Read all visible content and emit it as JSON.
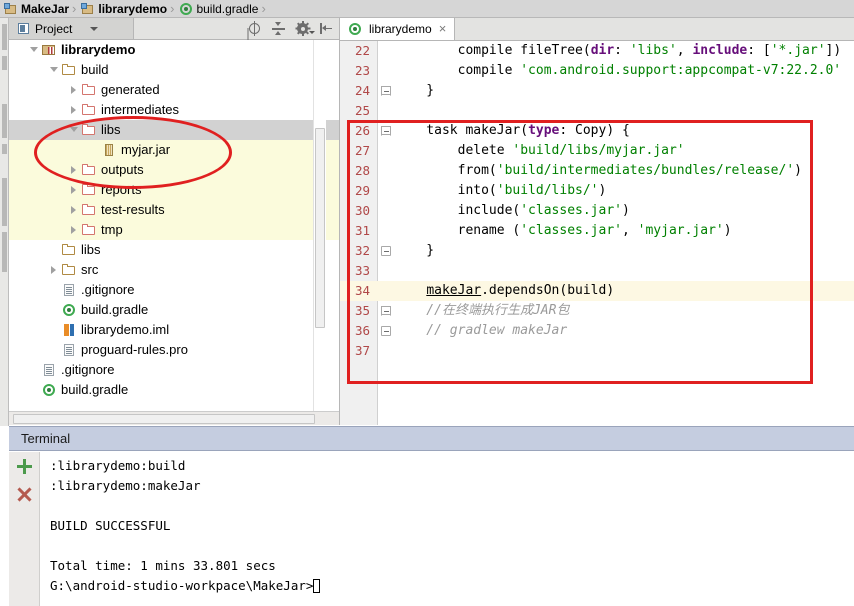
{
  "breadcrumb": {
    "items": [
      {
        "label": "MakeJar",
        "icon": "module-icon",
        "bold": true
      },
      {
        "label": "librarydemo",
        "icon": "module-icon",
        "bold": true
      },
      {
        "label": "build.gradle",
        "icon": "gradle-icon",
        "bold": false
      }
    ],
    "separator": "›"
  },
  "project_panel": {
    "tab_label": "Project",
    "tools": [
      {
        "name": "locate-icon",
        "title": "Scroll from Source"
      },
      {
        "name": "collapse-all-icon",
        "title": "Collapse All"
      },
      {
        "name": "gear-icon",
        "title": "Settings"
      },
      {
        "name": "hide-window-icon",
        "title": "Hide"
      }
    ],
    "tree": [
      {
        "label": "librarydemo",
        "indent": 0,
        "icon": "library-module-icon",
        "twisty": "open",
        "bold": true,
        "state": "normal"
      },
      {
        "label": "build",
        "indent": 1,
        "icon": "folder-icon",
        "twisty": "open",
        "bold": false,
        "state": "normal"
      },
      {
        "label": "generated",
        "indent": 2,
        "icon": "folder-red-icon",
        "twisty": "closed",
        "bold": false,
        "state": "normal"
      },
      {
        "label": "intermediates",
        "indent": 2,
        "icon": "folder-red-icon",
        "twisty": "closed",
        "bold": false,
        "state": "normal"
      },
      {
        "label": "libs",
        "indent": 2,
        "icon": "folder-red-icon",
        "twisty": "open",
        "bold": false,
        "state": "selected"
      },
      {
        "label": "myjar.jar",
        "indent": 3,
        "icon": "jar-icon",
        "twisty": "none",
        "bold": false,
        "state": "highlight"
      },
      {
        "label": "outputs",
        "indent": 2,
        "icon": "folder-red-icon",
        "twisty": "closed",
        "bold": false,
        "state": "highlight"
      },
      {
        "label": "reports",
        "indent": 2,
        "icon": "folder-red-icon",
        "twisty": "closed",
        "bold": false,
        "state": "highlight"
      },
      {
        "label": "test-results",
        "indent": 2,
        "icon": "folder-red-icon",
        "twisty": "closed",
        "bold": false,
        "state": "highlight"
      },
      {
        "label": "tmp",
        "indent": 2,
        "icon": "folder-red-icon",
        "twisty": "closed",
        "bold": false,
        "state": "highlight"
      },
      {
        "label": "libs",
        "indent": 1,
        "icon": "folder-icon",
        "twisty": "none",
        "bold": false,
        "state": "normal"
      },
      {
        "label": "src",
        "indent": 1,
        "icon": "folder-icon",
        "twisty": "closed",
        "bold": false,
        "state": "normal"
      },
      {
        "label": ".gitignore",
        "indent": 1,
        "icon": "file-icon",
        "twisty": "none",
        "bold": false,
        "state": "normal"
      },
      {
        "label": "build.gradle",
        "indent": 1,
        "icon": "gradle-file-icon",
        "twisty": "none",
        "bold": false,
        "state": "normal"
      },
      {
        "label": "librarydemo.iml",
        "indent": 1,
        "icon": "iml-icon",
        "twisty": "none",
        "bold": false,
        "state": "normal"
      },
      {
        "label": "proguard-rules.pro",
        "indent": 1,
        "icon": "file-icon",
        "twisty": "none",
        "bold": false,
        "state": "normal"
      },
      {
        "label": ".gitignore",
        "indent": 0,
        "icon": "file-icon",
        "twisty": "none",
        "bold": false,
        "state": "normal"
      },
      {
        "label": "build.gradle",
        "indent": 0,
        "icon": "gradle-file-icon",
        "twisty": "none",
        "bold": false,
        "state": "normal"
      }
    ]
  },
  "editor": {
    "tab": {
      "label": "librarydemo",
      "icon": "gradle-icon",
      "close": "×"
    },
    "lines": [
      {
        "num": "22",
        "fold": "none",
        "highlight": false,
        "tokens": [
          {
            "t": "        ",
            "c": "plain"
          },
          {
            "t": "compile fileTree(",
            "c": "plain"
          },
          {
            "t": "dir",
            "c": "attr"
          },
          {
            "t": ": ",
            "c": "plain"
          },
          {
            "t": "'libs'",
            "c": "str"
          },
          {
            "t": ", ",
            "c": "plain"
          },
          {
            "t": "include",
            "c": "attr"
          },
          {
            "t": ": [",
            "c": "plain"
          },
          {
            "t": "'*.jar'",
            "c": "str"
          },
          {
            "t": "])",
            "c": "plain"
          }
        ]
      },
      {
        "num": "23",
        "fold": "none",
        "highlight": false,
        "tokens": [
          {
            "t": "        compile ",
            "c": "plain"
          },
          {
            "t": "'com.android.support:appcompat-v7:22.2.0'",
            "c": "str"
          }
        ]
      },
      {
        "num": "24",
        "fold": "tri",
        "highlight": false,
        "tokens": [
          {
            "t": "    }",
            "c": "plain"
          }
        ]
      },
      {
        "num": "25",
        "fold": "none",
        "highlight": false,
        "tokens": [
          {
            "t": "",
            "c": "plain"
          }
        ]
      },
      {
        "num": "26",
        "fold": "tri",
        "highlight": false,
        "tokens": [
          {
            "t": "    task makeJar(",
            "c": "plain"
          },
          {
            "t": "type",
            "c": "attr"
          },
          {
            "t": ": Copy) {",
            "c": "plain"
          }
        ]
      },
      {
        "num": "27",
        "fold": "none",
        "highlight": false,
        "tokens": [
          {
            "t": "        delete ",
            "c": "plain"
          },
          {
            "t": "'build/libs/myjar.jar'",
            "c": "str"
          }
        ]
      },
      {
        "num": "28",
        "fold": "none",
        "highlight": false,
        "tokens": [
          {
            "t": "        from(",
            "c": "plain"
          },
          {
            "t": "'build/intermediates/bundles/release/'",
            "c": "str"
          },
          {
            "t": ")",
            "c": "plain"
          }
        ]
      },
      {
        "num": "29",
        "fold": "none",
        "highlight": false,
        "tokens": [
          {
            "t": "        into(",
            "c": "plain"
          },
          {
            "t": "'build/libs/'",
            "c": "str"
          },
          {
            "t": ")",
            "c": "plain"
          }
        ]
      },
      {
        "num": "30",
        "fold": "none",
        "highlight": false,
        "tokens": [
          {
            "t": "        include(",
            "c": "plain"
          },
          {
            "t": "'classes.jar'",
            "c": "str"
          },
          {
            "t": ")",
            "c": "plain"
          }
        ]
      },
      {
        "num": "31",
        "fold": "none",
        "highlight": false,
        "tokens": [
          {
            "t": "        rename (",
            "c": "plain"
          },
          {
            "t": "'classes.jar'",
            "c": "str"
          },
          {
            "t": ", ",
            "c": "plain"
          },
          {
            "t": "'myjar.jar'",
            "c": "str"
          },
          {
            "t": ")",
            "c": "plain"
          }
        ]
      },
      {
        "num": "32",
        "fold": "minus",
        "highlight": false,
        "tokens": [
          {
            "t": "    }",
            "c": "plain"
          }
        ]
      },
      {
        "num": "33",
        "fold": "none",
        "highlight": false,
        "tokens": [
          {
            "t": "",
            "c": "plain"
          }
        ]
      },
      {
        "num": "34",
        "fold": "none",
        "highlight": true,
        "tokens": [
          {
            "t": "    ",
            "c": "plain"
          },
          {
            "t": "makeJar",
            "c": "ul"
          },
          {
            "t": ".dependsOn(build)",
            "c": "plain"
          }
        ]
      },
      {
        "num": "35",
        "fold": "tri",
        "highlight": false,
        "tokens": [
          {
            "t": "    //在终端执行生成JAR包",
            "c": "cmt"
          }
        ]
      },
      {
        "num": "36",
        "fold": "minus",
        "highlight": false,
        "tokens": [
          {
            "t": "    // gradlew makeJar",
            "c": "cmt"
          }
        ]
      },
      {
        "num": "37",
        "fold": "none",
        "highlight": false,
        "tokens": [
          {
            "t": "",
            "c": "plain"
          }
        ]
      }
    ]
  },
  "annotations": {
    "ellipse": {
      "color": "#e02020",
      "label": "red-ellipse-highlighting-myjar-jar"
    },
    "rect": {
      "color": "#e02020",
      "label": "red-rectangle-highlighting-makejar-task"
    }
  },
  "terminal": {
    "title": "Terminal",
    "actions": [
      {
        "name": "new-session-icon",
        "label": "+"
      },
      {
        "name": "close-session-icon",
        "label": "×"
      }
    ],
    "lines": [
      ":librarydemo:build",
      ":librarydemo:makeJar",
      "",
      "BUILD SUCCESSFUL",
      "",
      "Total time: 1 mins 33.801 secs"
    ],
    "prompt": "G:\\android-studio-workpace\\MakeJar>"
  }
}
